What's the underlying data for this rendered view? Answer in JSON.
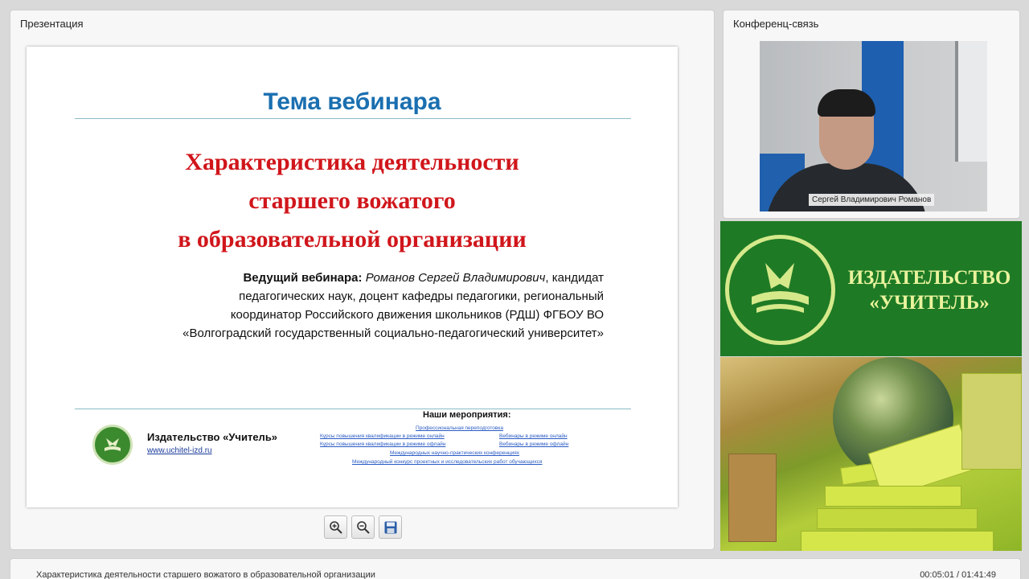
{
  "presentation": {
    "panel_title": "Презентация",
    "slide": {
      "topic": "Тема вебинара",
      "title_lines": [
        "Характеристика деятельности",
        "старшего вожатого",
        "в образовательной организации"
      ],
      "host_label": "Ведущий вебинара:",
      "host_name": "Романов Сергей Владимирович",
      "host_line1_rest": ", кандидат",
      "host_lines": [
        "педагогических наук, доцент кафедры педагогики, региональный",
        "координатор Российского движения школьников (РДШ) ФГБОУ ВО",
        "«Волгоградский государственный социально-педагогический университет»"
      ],
      "publisher_name": "Издательство «Учитель»",
      "publisher_url": "www.uchitel-izd.ru",
      "events_heading": "Наши мероприятия",
      "events": [
        "Профессиональная переподготовка",
        "Курсы повышения квалификации в режиме онлайн",
        "Вебинары в режиме онлайн",
        "Курсы повышения квалификации в режиме офлайн",
        "Вебинары в режиме офлайн",
        "Международных научно-практических конференциях",
        "Международный конкурс проектных и исследовательских работ обучающихся"
      ]
    },
    "toolbar": {
      "zoom_in": "zoom-in-icon",
      "zoom_out": "zoom-out-icon",
      "save": "save-icon"
    }
  },
  "conference": {
    "panel_title": "Конференц-связь",
    "speaker_name": "Сергей Владимирович Романов"
  },
  "banner": {
    "line1": "ИЗДАТЕЛЬСТВО",
    "line2": "«УЧИТЕЛЬ»"
  },
  "footer": {
    "title": "Характеристика деятельности старшего вожатого  в образовательной организации",
    "time": "00:05:01 / 01:41:49"
  },
  "colors": {
    "topic": "#1a6fb0",
    "title": "#d0161b",
    "banner_bg": "#1e7a25",
    "banner_text": "#e9f39c",
    "link": "#2a5bc4"
  }
}
